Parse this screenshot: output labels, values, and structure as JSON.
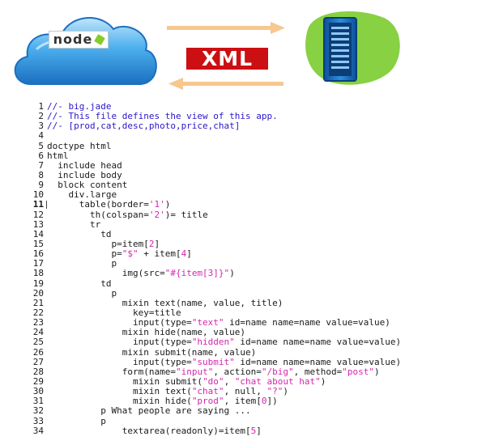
{
  "hero": {
    "client_logo_text": "node",
    "protocol_label": "XML",
    "colors": {
      "cloud": "#2f93da",
      "cloud_light": "#bfe5fb",
      "arrow": "#f7c78f",
      "server_blob": "#87d143",
      "server_body": "#1b7ecf",
      "xml_background": "#cc0f12"
    }
  },
  "code": {
    "current_line": 11,
    "colors": {
      "text": "#1a1a1a",
      "comment": "#2a16c8",
      "string": "#d626b0"
    },
    "lines": [
      {
        "n": 1,
        "parts": [
          {
            "t": "//- big.jade",
            "k": "cmt"
          }
        ]
      },
      {
        "n": 2,
        "parts": [
          {
            "t": "//- This file defines the view of this app.",
            "k": "cmt"
          }
        ]
      },
      {
        "n": 3,
        "parts": [
          {
            "t": "//- [prod,cat,desc,photo,price,chat]",
            "k": "cmt"
          }
        ]
      },
      {
        "n": 4,
        "parts": []
      },
      {
        "n": 5,
        "parts": [
          {
            "t": "doctype html",
            "k": "src"
          }
        ]
      },
      {
        "n": 6,
        "parts": [
          {
            "t": "html",
            "k": "src"
          }
        ]
      },
      {
        "n": 7,
        "parts": [
          {
            "t": "  include head",
            "k": "src"
          }
        ]
      },
      {
        "n": 8,
        "parts": [
          {
            "t": "  include body",
            "k": "src"
          }
        ]
      },
      {
        "n": 9,
        "parts": [
          {
            "t": "  block content",
            "k": "src"
          }
        ]
      },
      {
        "n": 10,
        "parts": [
          {
            "t": "    div.large",
            "k": "src"
          }
        ]
      },
      {
        "n": 11,
        "parts": [
          {
            "t": "      table(border=",
            "k": "src"
          },
          {
            "t": "'1'",
            "k": "str"
          },
          {
            "t": ")",
            "k": "src"
          }
        ]
      },
      {
        "n": 12,
        "parts": [
          {
            "t": "        th(colspan=",
            "k": "src"
          },
          {
            "t": "'2'",
            "k": "str"
          },
          {
            "t": ")= title",
            "k": "src"
          }
        ]
      },
      {
        "n": 13,
        "parts": [
          {
            "t": "        tr",
            "k": "src"
          }
        ]
      },
      {
        "n": 14,
        "parts": [
          {
            "t": "          td",
            "k": "src"
          }
        ]
      },
      {
        "n": 15,
        "parts": [
          {
            "t": "            p=item[",
            "k": "src"
          },
          {
            "t": "2",
            "k": "str"
          },
          {
            "t": "]",
            "k": "src"
          }
        ]
      },
      {
        "n": 16,
        "parts": [
          {
            "t": "            p=",
            "k": "src"
          },
          {
            "t": "\"$\"",
            "k": "str"
          },
          {
            "t": " + item[",
            "k": "src"
          },
          {
            "t": "4",
            "k": "str"
          },
          {
            "t": "]",
            "k": "src"
          }
        ]
      },
      {
        "n": 17,
        "parts": [
          {
            "t": "            p",
            "k": "src"
          }
        ]
      },
      {
        "n": 18,
        "parts": [
          {
            "t": "              img(src=",
            "k": "src"
          },
          {
            "t": "\"#{item[3]}\"",
            "k": "str"
          },
          {
            "t": ")",
            "k": "src"
          }
        ]
      },
      {
        "n": 19,
        "parts": [
          {
            "t": "          td",
            "k": "src"
          }
        ]
      },
      {
        "n": 20,
        "parts": [
          {
            "t": "            p",
            "k": "src"
          }
        ]
      },
      {
        "n": 21,
        "parts": [
          {
            "t": "              mixin text(name, value, title)",
            "k": "src"
          }
        ]
      },
      {
        "n": 22,
        "parts": [
          {
            "t": "                key=title",
            "k": "src"
          }
        ]
      },
      {
        "n": 23,
        "parts": [
          {
            "t": "                input(type=",
            "k": "src"
          },
          {
            "t": "\"text\"",
            "k": "str"
          },
          {
            "t": " id=name name=name value=value)",
            "k": "src"
          }
        ]
      },
      {
        "n": 24,
        "parts": [
          {
            "t": "              mixin hide(name, value)",
            "k": "src"
          }
        ]
      },
      {
        "n": 25,
        "parts": [
          {
            "t": "                input(type=",
            "k": "src"
          },
          {
            "t": "\"hidden\"",
            "k": "str"
          },
          {
            "t": " id=name name=name value=value)",
            "k": "src"
          }
        ]
      },
      {
        "n": 26,
        "parts": [
          {
            "t": "              mixin submit(name, value)",
            "k": "src"
          }
        ]
      },
      {
        "n": 27,
        "parts": [
          {
            "t": "                input(type=",
            "k": "src"
          },
          {
            "t": "\"submit\"",
            "k": "str"
          },
          {
            "t": " id=name name=name value=value)",
            "k": "src"
          }
        ]
      },
      {
        "n": 28,
        "parts": [
          {
            "t": "              form(name=",
            "k": "src"
          },
          {
            "t": "\"input\"",
            "k": "str"
          },
          {
            "t": ", action=",
            "k": "src"
          },
          {
            "t": "\"/big\"",
            "k": "str"
          },
          {
            "t": ", method=",
            "k": "src"
          },
          {
            "t": "\"post\"",
            "k": "str"
          },
          {
            "t": ")",
            "k": "src"
          }
        ]
      },
      {
        "n": 29,
        "parts": [
          {
            "t": "                mixin submit(",
            "k": "src"
          },
          {
            "t": "\"do\"",
            "k": "str"
          },
          {
            "t": ", ",
            "k": "src"
          },
          {
            "t": "\"chat about hat\"",
            "k": "str"
          },
          {
            "t": ")",
            "k": "src"
          }
        ]
      },
      {
        "n": 30,
        "parts": [
          {
            "t": "                mixin text(",
            "k": "src"
          },
          {
            "t": "\"chat\"",
            "k": "str"
          },
          {
            "t": ", null, ",
            "k": "src"
          },
          {
            "t": "\"?\"",
            "k": "str"
          },
          {
            "t": ")",
            "k": "src"
          }
        ]
      },
      {
        "n": 31,
        "parts": [
          {
            "t": "                mixin hide(",
            "k": "src"
          },
          {
            "t": "\"prod\"",
            "k": "str"
          },
          {
            "t": ", item[",
            "k": "src"
          },
          {
            "t": "0",
            "k": "str"
          },
          {
            "t": "])",
            "k": "src"
          }
        ]
      },
      {
        "n": 32,
        "parts": [
          {
            "t": "          p What people are saying ...",
            "k": "src"
          }
        ]
      },
      {
        "n": 33,
        "parts": [
          {
            "t": "          p",
            "k": "src"
          }
        ]
      },
      {
        "n": 34,
        "parts": [
          {
            "t": "              textarea(readonly)=item[",
            "k": "src"
          },
          {
            "t": "5",
            "k": "str"
          },
          {
            "t": "]",
            "k": "src"
          }
        ]
      }
    ]
  }
}
